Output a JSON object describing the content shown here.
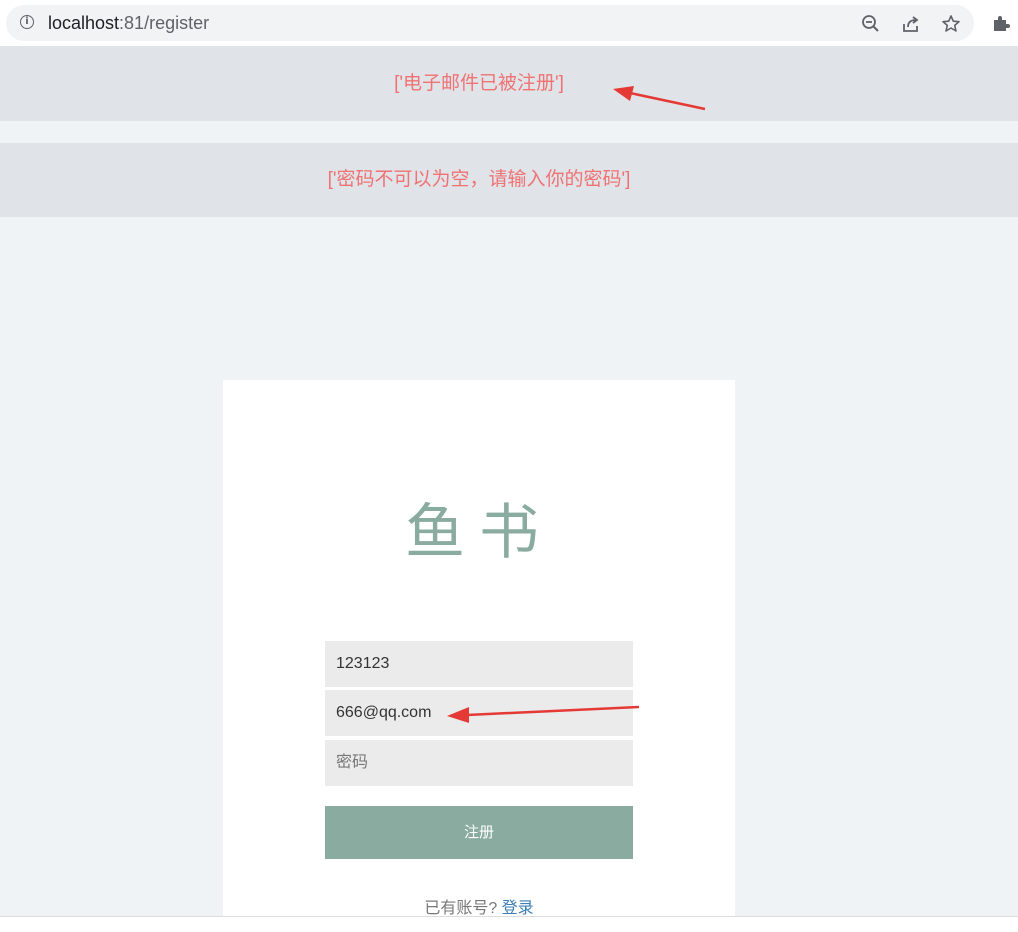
{
  "browser": {
    "url_host": "localhost",
    "url_rest": ":81/register",
    "info_icon": "info-icon",
    "toolbar_icons": [
      "zoom-out-icon",
      "share-icon",
      "star-icon",
      "extension-icon"
    ]
  },
  "flash_messages": [
    "['电子邮件已被注册']",
    "['密码不可以为空，请输入你的密码']"
  ],
  "form": {
    "logo": "鱼书",
    "username_value": "123123",
    "email_value": "666@qq.com",
    "password_placeholder": "密码",
    "submit_label": "注册",
    "login_prompt": "已有账号?",
    "login_link": "登录"
  },
  "colors": {
    "accent": "#8aab9f",
    "flash_text": "#f07273",
    "flash_bg": "#e0e3e8",
    "link": "#3b7fb5",
    "annotation_arrow": "#e53935"
  }
}
